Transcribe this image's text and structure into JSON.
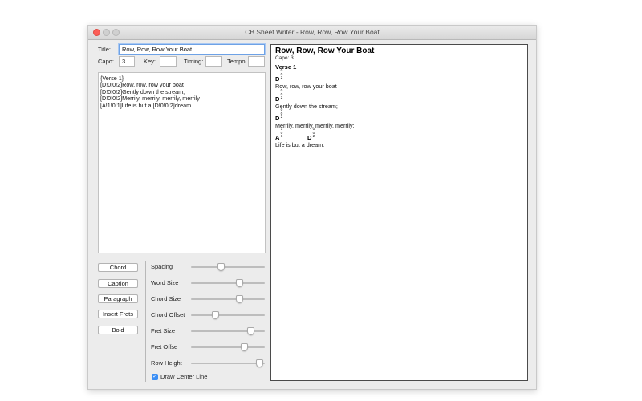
{
  "window": {
    "title": "CB Sheet Writer - Row, Row, Row Your Boat"
  },
  "form": {
    "title_label": "Title:",
    "title_value": "Row, Row, Row Your Boat",
    "capo_label": "Capo:",
    "capo_value": "3",
    "key_label": "Key:",
    "key_value": "",
    "timing_label": "Timing:",
    "timing_value": "",
    "tempo_label": "Tempo:",
    "tempo_value": ""
  },
  "editor": {
    "lines": [
      "{Verse 1}",
      "[D!0!0!2]Row, row, row your boat",
      "[D!0!0!2]Gently down the stream;",
      "[D!0!0!2]Merrily, merrily, merrily, merrily",
      "[A!1!0!1]Life is but a [D!0!0!2]dream."
    ]
  },
  "buttons": {
    "chord": "Chord",
    "caption": "Caption",
    "paragraph": "Paragraph",
    "insert_frets": "Insert Frets",
    "bold": "Bold"
  },
  "sliders": [
    {
      "label": "Spacing",
      "value": 0.4
    },
    {
      "label": "Word Size",
      "value": 0.65
    },
    {
      "label": "Chord Size",
      "value": 0.65
    },
    {
      "label": "Chord Offset",
      "value": 0.33
    },
    {
      "label": "Fret Size",
      "value": 0.8
    },
    {
      "label": "Fret Offse",
      "value": 0.72
    },
    {
      "label": "Row Height",
      "value": 0.92
    }
  ],
  "draw_center_line": {
    "label": "Draw Center Line",
    "checked": true
  },
  "preview": {
    "title": "Row, Row, Row Your Boat",
    "capo": "Capo: 3",
    "verse_label": "Verse 1",
    "lines": [
      {
        "lyric": "Row, row, row your boat",
        "chords": [
          {
            "name": "D",
            "frets": [
              "0",
              "0",
              "2"
            ]
          }
        ]
      },
      {
        "lyric": "Gently down the stream;",
        "chords": [
          {
            "name": "D",
            "frets": [
              "0",
              "0",
              "2"
            ]
          }
        ]
      },
      {
        "lyric": "Merrily, merrily, merrily, merrily:",
        "chords": [
          {
            "name": "D",
            "frets": [
              "0",
              "0",
              "2"
            ]
          }
        ]
      },
      {
        "lyric": "Life is but a dream.",
        "chords": [
          {
            "name": "A",
            "frets": [
              "1",
              "0",
              "1"
            ]
          },
          {
            "name": "D",
            "frets": [
              "0",
              "0",
              "2"
            ]
          }
        ]
      }
    ]
  }
}
